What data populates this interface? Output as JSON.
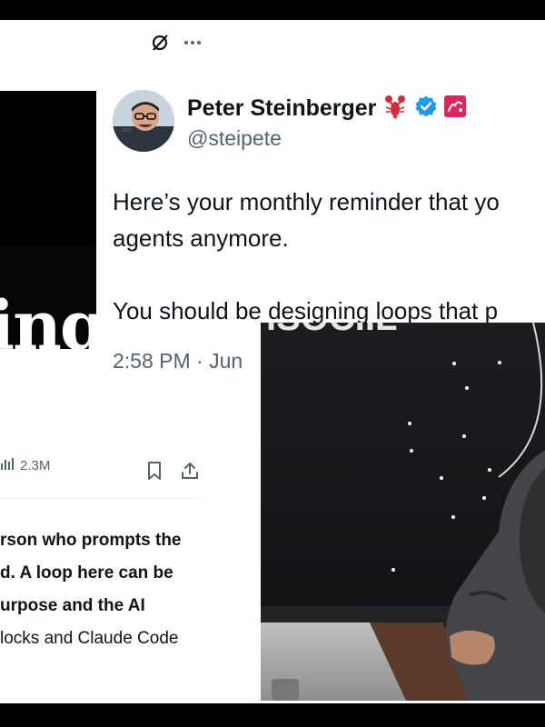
{
  "profile": {
    "display_name": "Peter Steinberger",
    "handle": "@steipete",
    "badges": [
      "lobster-emoji",
      "verified-badge-icon",
      "affiliate-badge"
    ]
  },
  "tweet": {
    "line1": "Here’s your monthly reminder that yo",
    "line2": "agents anymore.",
    "line3": "You should be designing loops that p",
    "timestamp": "2:58 PM · Jun"
  },
  "thumbnail": {
    "text": "ing"
  },
  "stats": {
    "views": "2.3M"
  },
  "article": {
    "lines": [
      {
        "text": "rson who prompts the",
        "bold": true
      },
      {
        "text": "d. A loop here can be",
        "bold": true
      },
      {
        "text": "urpose and the AI",
        "bold": true
      },
      {
        "text": "locks and Claude Code",
        "bold": false
      }
    ]
  },
  "photo": {
    "sign_text": "ISOCIIL"
  },
  "colors": {
    "text": "#0f1419",
    "muted": "#536471",
    "verified": "#1d9bf0",
    "affiliate": "#e0245e"
  }
}
